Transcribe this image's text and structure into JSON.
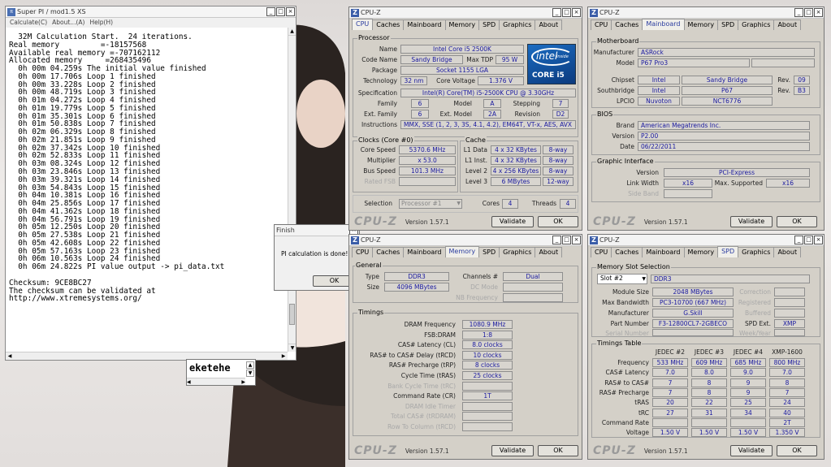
{
  "superpi": {
    "title": "Super PI / mod1.5 XS",
    "menu": [
      "Calculate(C)",
      "About...(A)",
      "Help(H)"
    ],
    "lines": [
      "  32M Calculation Start.  24 iterations.",
      "Real memory         =-18157568",
      "Available real memory =-707162112",
      "Allocated memory     =268435496",
      "  0h 00m 04.259s The initial value finished",
      "  0h 00m 17.706s Loop 1 finished",
      "  0h 00m 33.228s Loop 2 finished",
      "  0h 00m 48.719s Loop 3 finished",
      "  0h 01m 04.272s Loop 4 finished",
      "  0h 01m 19.779s Loop 5 finished",
      "  0h 01m 35.301s Loop 6 finished",
      "  0h 01m 50.838s Loop 7 finished",
      "  0h 02m 06.329s Loop 8 finished",
      "  0h 02m 21.851s Loop 9 finished",
      "  0h 02m 37.342s Loop 10 finished",
      "  0h 02m 52.833s Loop 11 finished",
      "  0h 03m 08.324s Loop 12 finished",
      "  0h 03m 23.846s Loop 13 finished",
      "  0h 03m 39.321s Loop 14 finished",
      "  0h 03m 54.843s Loop 15 finished",
      "  0h 04m 10.381s Loop 16 finished",
      "  0h 04m 25.856s Loop 17 finished",
      "  0h 04m 41.362s Loop 18 finished",
      "  0h 04m 56.791s Loop 19 finished",
      "  0h 05m 12.250s Loop 20 finished",
      "  0h 05m 27.538s Loop 21 finished",
      "  0h 05m 42.608s Loop 22 finished",
      "  0h 05m 57.163s Loop 23 finished",
      "  0h 06m 10.563s Loop 24 finished",
      "  0h 06m 24.822s PI value output -> pi_data.txt",
      "",
      "Checksum: 9CE8BC27",
      "The checksum can be validated at",
      "http://www.xtremesystems.org/"
    ]
  },
  "finish": {
    "title": "Finish",
    "message": "PI calculation is done!",
    "ok": "OK"
  },
  "mini": {
    "text": "eketehe"
  },
  "cpuz": {
    "title": "CPU-Z",
    "version": "Version 1.57.1",
    "footer_logo": "CPU-Z",
    "validate": "Validate",
    "ok": "OK",
    "tabs": [
      "CPU",
      "Caches",
      "Mainboard",
      "Memory",
      "SPD",
      "Graphics",
      "About"
    ]
  },
  "cpu": {
    "processor_group": "Processor",
    "name_l": "Name",
    "name": "Intel Core i5 2500K",
    "codename_l": "Code Name",
    "codename": "Sandy Bridge",
    "maxtdp_l": "Max TDP",
    "maxtdp": "95 W",
    "package_l": "Package",
    "package": "Socket 1155 LGA",
    "tech_l": "Technology",
    "tech": "32 nm",
    "voltage_l": "Core Voltage",
    "voltage": "1.376 V",
    "spec_l": "Specification",
    "spec": "Intel(R) Core(TM) i5-2500K CPU @ 3.30GHz",
    "family_l": "Family",
    "family": "6",
    "model_l": "Model",
    "model": "A",
    "stepping_l": "Stepping",
    "stepping": "7",
    "extfamily_l": "Ext. Family",
    "extfamily": "6",
    "extmodel_l": "Ext. Model",
    "extmodel": "2A",
    "revision_l": "Revision",
    "revision": "D2",
    "instr_l": "Instructions",
    "instr": "MMX, SSE (1, 2, 3, 3S, 4.1, 4.2), EM64T, VT-x, AES, AVX",
    "clocks_group": "Clocks (Core #0)",
    "corespeed_l": "Core Speed",
    "corespeed": "5370.6 MHz",
    "multiplier_l": "Multiplier",
    "multiplier": "x 53.0",
    "busspeed_l": "Bus Speed",
    "busspeed": "101.3 MHz",
    "ratedfsb_l": "Rated FSB",
    "cache_group": "Cache",
    "l1d_l": "L1 Data",
    "l1d": "4 x 32 KBytes",
    "l1d_way": "8-way",
    "l1i_l": "L1 Inst.",
    "l1i": "4 x 32 KBytes",
    "l1i_way": "8-way",
    "l2_l": "Level 2",
    "l2": "4 x 256 KBytes",
    "l2_way": "8-way",
    "l3_l": "Level 3",
    "l3": "6 MBytes",
    "l3_way": "12-way",
    "selection_l": "Selection",
    "selection": "Processor #1",
    "cores_l": "Cores",
    "cores": "4",
    "threads_l": "Threads",
    "threads": "4",
    "logo_brand": "intel",
    "logo_inside": "inside",
    "logo_line": "CORE i5"
  },
  "mainboard": {
    "mb_group": "Motherboard",
    "manufacturer_l": "Manufacturer",
    "manufacturer": "ASRock",
    "model_l": "Model",
    "model": "P67 Pro3",
    "chipset_l": "Chipset",
    "chipset_v": "Intel",
    "chipset": "Sandy Bridge",
    "chipset_rev_l": "Rev.",
    "chipset_rev": "09",
    "south_l": "Southbridge",
    "south_v": "Intel",
    "south": "P67",
    "south_rev_l": "Rev.",
    "south_rev": "B3",
    "lpcio_l": "LPCIO",
    "lpcio_v": "Nuvoton",
    "lpcio": "NCT6776",
    "bios_group": "BIOS",
    "brand_l": "Brand",
    "brand": "American Megatrends Inc.",
    "version_l": "Version",
    "version": "P2.00",
    "date_l": "Date",
    "date": "06/22/2011",
    "gi_group": "Graphic Interface",
    "giversion_l": "Version",
    "giversion": "PCI-Express",
    "linkwidth_l": "Link Width",
    "linkwidth": "x16",
    "maxsup_l": "Max. Supported",
    "maxsup": "x16",
    "sideband_l": "Side Band"
  },
  "memory": {
    "general_group": "General",
    "type_l": "Type",
    "type": "DDR3",
    "channels_l": "Channels #",
    "channels": "Dual",
    "size_l": "Size",
    "size": "4096 MBytes",
    "dcmode_l": "DC Mode",
    "nbfreq_l": "NB Frequency",
    "timings_group": "Timings",
    "rows": [
      {
        "l": "DRAM Frequency",
        "v": "1080.9 MHz",
        "dis": false
      },
      {
        "l": "FSB:DRAM",
        "v": "1:8",
        "dis": false
      },
      {
        "l": "CAS# Latency (CL)",
        "v": "8.0 clocks",
        "dis": false
      },
      {
        "l": "RAS# to CAS# Delay (tRCD)",
        "v": "10 clocks",
        "dis": false
      },
      {
        "l": "RAS# Precharge (tRP)",
        "v": "8 clocks",
        "dis": false
      },
      {
        "l": "Cycle Time (tRAS)",
        "v": "25 clocks",
        "dis": false
      },
      {
        "l": "Bank Cycle Time (tRC)",
        "v": "",
        "dis": true
      },
      {
        "l": "Command Rate (CR)",
        "v": "1T",
        "dis": false
      },
      {
        "l": "DRAM Idle Timer",
        "v": "",
        "dis": true
      },
      {
        "l": "Total CAS# (tRDRAM)",
        "v": "",
        "dis": true
      },
      {
        "l": "Row To Column (tRCD)",
        "v": "",
        "dis": true
      }
    ]
  },
  "spd": {
    "slot_group": "Memory Slot Selection",
    "slot": "Slot #2",
    "slot_type": "DDR3",
    "modsize_l": "Module Size",
    "modsize": "2048 MBytes",
    "correction_l": "Correction",
    "maxbw_l": "Max Bandwidth",
    "maxbw": "PC3-10700 (667 MHz)",
    "registered_l": "Registered",
    "manufacturer_l": "Manufacturer",
    "manufacturer": "G.Skill",
    "buffered_l": "Buffered",
    "part_l": "Part Number",
    "part": "F3-12800CL7-2GBECO",
    "spdext_l": "SPD Ext.",
    "spdext": "XMP",
    "serial_l": "Serial Number",
    "week_l": "Week/Year",
    "timings_group": "Timings Table",
    "cols": [
      "JEDEC #2",
      "JEDEC #3",
      "JEDEC #4",
      "XMP-1600"
    ],
    "rows": [
      {
        "l": "Frequency",
        "v": [
          "533 MHz",
          "609 MHz",
          "685 MHz",
          "800 MHz"
        ]
      },
      {
        "l": "CAS# Latency",
        "v": [
          "7.0",
          "8.0",
          "9.0",
          "7.0"
        ]
      },
      {
        "l": "RAS# to CAS#",
        "v": [
          "7",
          "8",
          "9",
          "8"
        ]
      },
      {
        "l": "RAS# Precharge",
        "v": [
          "7",
          "8",
          "9",
          "7"
        ]
      },
      {
        "l": "tRAS",
        "v": [
          "20",
          "22",
          "25",
          "24"
        ]
      },
      {
        "l": "tRC",
        "v": [
          "27",
          "31",
          "34",
          "40"
        ]
      },
      {
        "l": "Command Rate",
        "v": [
          "",
          "",
          "",
          "2T"
        ]
      },
      {
        "l": "Voltage",
        "v": [
          "1.50 V",
          "1.50 V",
          "1.50 V",
          "1.350 V"
        ]
      }
    ]
  }
}
